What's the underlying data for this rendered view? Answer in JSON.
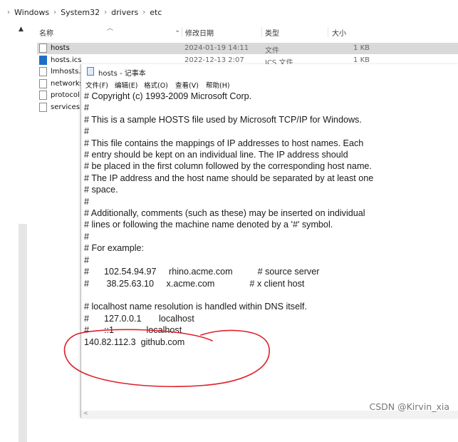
{
  "breadcrumb": {
    "items": [
      "Windows",
      "System32",
      "drivers",
      "etc"
    ],
    "separator": "›"
  },
  "file_list": {
    "columns": {
      "name": "名称",
      "date": "修改日期",
      "type": "类型",
      "size": "大小"
    },
    "rows": [
      {
        "name": "hosts",
        "date": "2024-01-19 14:11",
        "type": "文件",
        "size": "1 KB",
        "selected": true
      },
      {
        "name": "hosts.ics",
        "date": "2022-12-13 2:07",
        "type": "ICS 文件",
        "size": "1 KB"
      },
      {
        "name": "lmhosts.s",
        "date": "",
        "type": "",
        "size": ""
      },
      {
        "name": "networks",
        "date": "",
        "type": "",
        "size": ""
      },
      {
        "name": "protocol",
        "date": "",
        "type": "",
        "size": ""
      },
      {
        "name": "services",
        "date": "",
        "type": "",
        "size": ""
      }
    ]
  },
  "notepad": {
    "title": "hosts - 记事本",
    "menu": [
      "文件(F)",
      "编辑(E)",
      "格式(O)",
      "查看(V)",
      "帮助(H)"
    ],
    "content": "# Copyright (c) 1993-2009 Microsoft Corp.\n#\n# This is a sample HOSTS file used by Microsoft TCP/IP for Windows.\n#\n# This file contains the mappings of IP addresses to host names. Each\n# entry should be kept on an individual line. The IP address should\n# be placed in the first column followed by the corresponding host name.\n# The IP address and the host name should be separated by at least one\n# space.\n#\n# Additionally, comments (such as these) may be inserted on individual\n# lines or following the machine name denoted by a '#' symbol.\n#\n# For example:\n#\n#      102.54.94.97     rhino.acme.com          # source server\n#       38.25.63.10     x.acme.com              # x client host\n\n# localhost name resolution is handled within DNS itself.\n#\t127.0.0.1       localhost\n#\t::1             localhost\n140.82.112.3  github.com"
  },
  "annotation": {
    "color": "#e0202a",
    "shape": "hand-drawn ellipse"
  },
  "watermark": "CSDN @Kirvin_xia",
  "icons": [
    "chevron-right-icon",
    "sort-up-icon",
    "file-icon",
    "ics-file-icon",
    "notepad-icon",
    "scroll-left-icon"
  ]
}
